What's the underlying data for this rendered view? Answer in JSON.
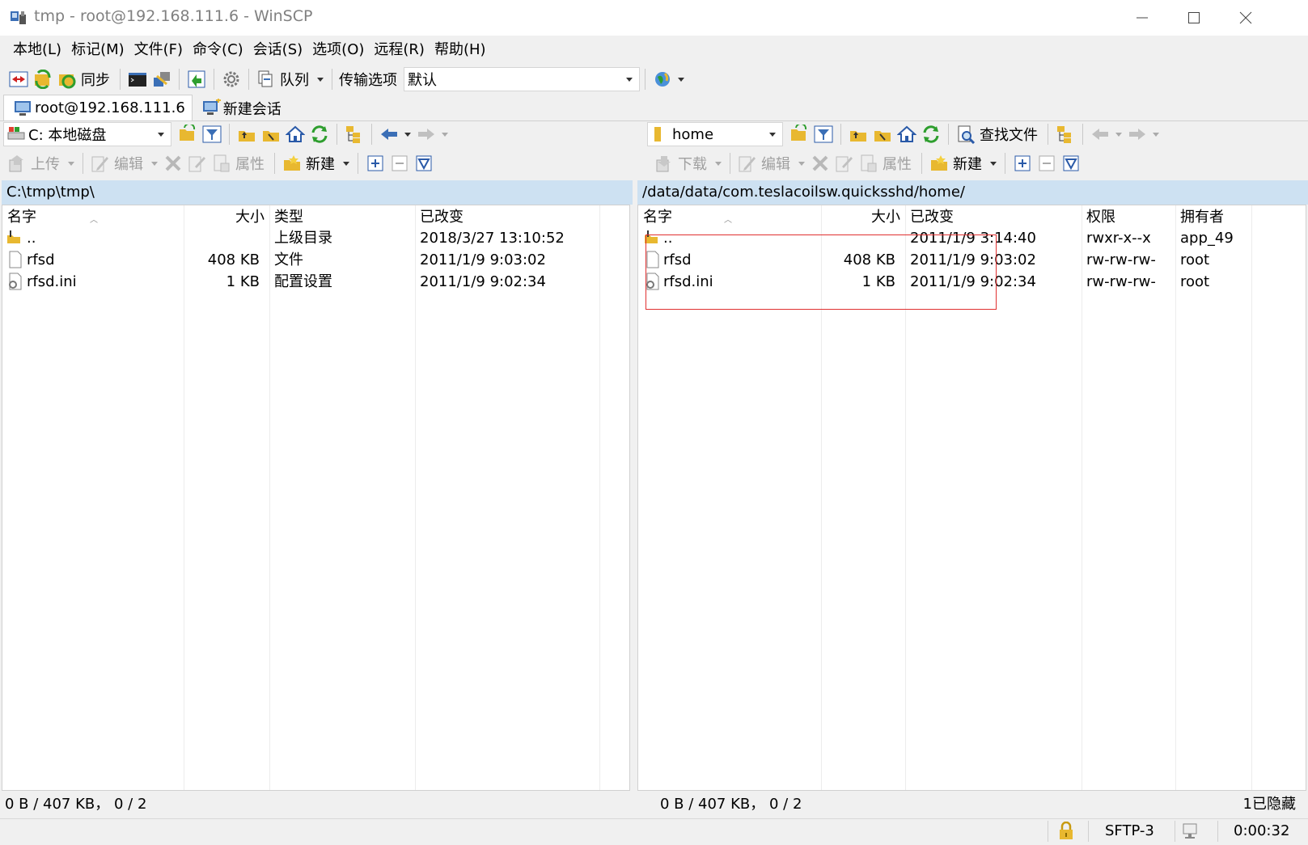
{
  "window": {
    "title": "tmp - root@192.168.111.6 - WinSCP"
  },
  "menu": [
    "本地(L)",
    "标记(M)",
    "文件(F)",
    "命令(C)",
    "会话(S)",
    "选项(O)",
    "远程(R)",
    "帮助(H)"
  ],
  "toolbar": {
    "sync_label": "同步",
    "queue_label": "队列",
    "transfer_options_label": "传输选项",
    "transfer_preset": "默认"
  },
  "tabs": {
    "session": "root@192.168.111.6",
    "new_session": "新建会话"
  },
  "local": {
    "drive": "C: 本地磁盘",
    "upload_label": "上传",
    "edit_label": "编辑",
    "properties_label": "属性",
    "new_label": "新建",
    "path": "C:\\tmp\\tmp\\",
    "columns": {
      "name": "名字",
      "size": "大小",
      "type": "类型",
      "changed": "已改变"
    },
    "files": [
      {
        "name": "..",
        "size": "",
        "type": "上级目录",
        "changed": "2018/3/27  13:10:52",
        "icon": "parent-folder-icon"
      },
      {
        "name": "rfsd",
        "size": "408 KB",
        "type": "文件",
        "changed": "2011/1/9  9:03:02",
        "icon": "file-icon"
      },
      {
        "name": "rfsd.ini",
        "size": "1 KB",
        "type": "配置设置",
        "changed": "2011/1/9  9:02:34",
        "icon": "config-file-icon"
      }
    ],
    "status": "0 B / 407 KB，  0 / 2"
  },
  "remote": {
    "directory": "home",
    "find_files_label": "查找文件",
    "download_label": "下载",
    "edit_label": "编辑",
    "properties_label": "属性",
    "new_label": "新建",
    "path": "/data/data/com.teslacoilsw.quicksshd/home/",
    "columns": {
      "name": "名字",
      "size": "大小",
      "changed": "已改变",
      "rights": "权限",
      "owner": "拥有者"
    },
    "files": [
      {
        "name": "..",
        "size": "",
        "changed": "2011/1/9 3:14:40",
        "rights": "rwxr-x--x",
        "owner": "app_49",
        "icon": "parent-folder-icon"
      },
      {
        "name": "rfsd",
        "size": "408 KB",
        "changed": "2011/1/9 9:03:02",
        "rights": "rw-rw-rw-",
        "owner": "root",
        "icon": "file-icon"
      },
      {
        "name": "rfsd.ini",
        "size": "1 KB",
        "changed": "2011/1/9 9:02:34",
        "rights": "rw-rw-rw-",
        "owner": "root",
        "icon": "config-file-icon"
      }
    ],
    "status": "0 B / 407 KB，  0 / 2",
    "hidden": "1已隐藏"
  },
  "statusbar": {
    "protocol": "SFTP-3",
    "elapsed": "0:00:32"
  },
  "colors": {
    "path_bar": "#cde1f2",
    "highlight_box": "#e03030",
    "folder": "#e8b830"
  }
}
